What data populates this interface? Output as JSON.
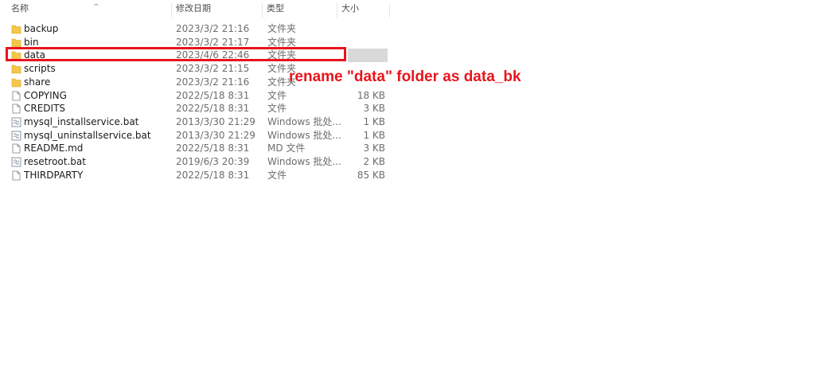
{
  "header": {
    "name_label": "名称",
    "date_label": "修改日期",
    "type_label": "类型",
    "size_label": "大小",
    "sort_arrow": "^"
  },
  "files": [
    {
      "name": "backup",
      "date": "2023/3/2 21:16",
      "type": "文件夹",
      "size": "",
      "icon": "folder-icon"
    },
    {
      "name": "bin",
      "date": "2023/3/2 21:17",
      "type": "文件夹",
      "size": "",
      "icon": "folder-icon"
    },
    {
      "name": "data",
      "date": "2023/4/6 22:46",
      "type": "文件夹",
      "size": "",
      "icon": "folder-icon"
    },
    {
      "name": "scripts",
      "date": "2023/3/2 21:15",
      "type": "文件夹",
      "size": "",
      "icon": "folder-icon"
    },
    {
      "name": "share",
      "date": "2023/3/2 21:16",
      "type": "文件夹",
      "size": "",
      "icon": "folder-icon"
    },
    {
      "name": "COPYING",
      "date": "2022/5/18 8:31",
      "type": "文件",
      "size": "18 KB",
      "icon": "file-icon"
    },
    {
      "name": "CREDITS",
      "date": "2022/5/18 8:31",
      "type": "文件",
      "size": "3 KB",
      "icon": "file-icon"
    },
    {
      "name": "mysql_installservice.bat",
      "date": "2013/3/30 21:29",
      "type": "Windows 批处...",
      "size": "1 KB",
      "icon": "batch-file-icon"
    },
    {
      "name": "mysql_uninstallservice.bat",
      "date": "2013/3/30 21:29",
      "type": "Windows 批处...",
      "size": "1 KB",
      "icon": "batch-file-icon"
    },
    {
      "name": "README.md",
      "date": "2022/5/18 8:31",
      "type": "MD 文件",
      "size": "3 KB",
      "icon": "file-icon"
    },
    {
      "name": "resetroot.bat",
      "date": "2019/6/3 20:39",
      "type": "Windows 批处...",
      "size": "2 KB",
      "icon": "batch-file-icon"
    },
    {
      "name": "THIRDPARTY",
      "date": "2022/5/18 8:31",
      "type": "文件",
      "size": "85 KB",
      "icon": "file-icon"
    }
  ],
  "annotation": {
    "text": "rename \"data\" folder as data_bk",
    "color": "#e8141c"
  },
  "colors": {
    "folder": "#f3c74a",
    "highlight": "#e8141c",
    "selection": "#d9d9d9"
  }
}
